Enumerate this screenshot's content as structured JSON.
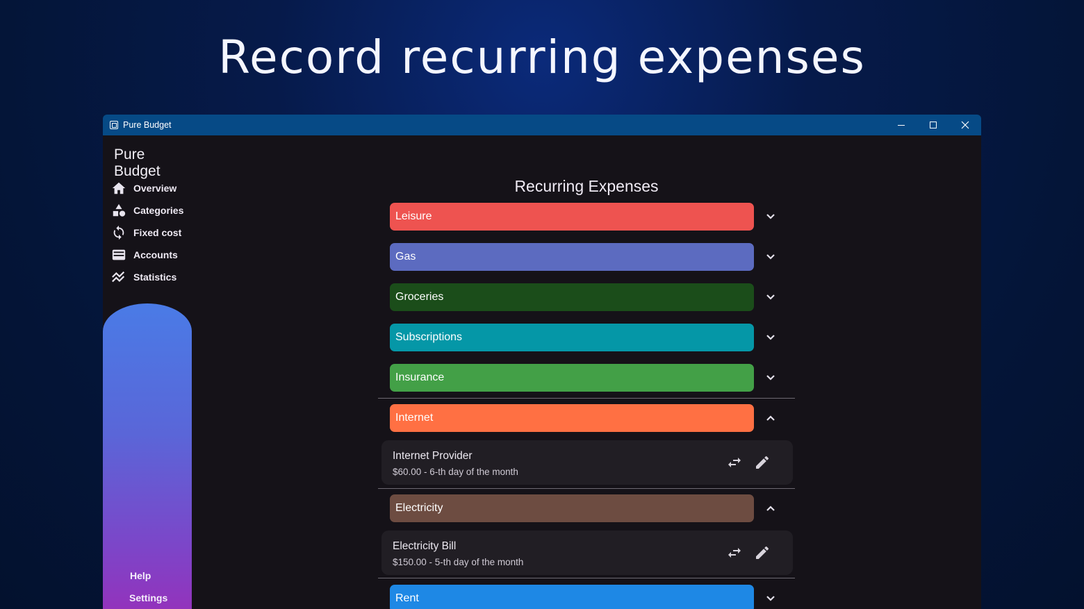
{
  "headline": "Record recurring expenses",
  "window": {
    "title": "Pure Budget",
    "controls": {
      "minimize": "minimize-icon",
      "maximize": "maximize-icon",
      "close": "close-icon"
    }
  },
  "sidebar": {
    "app_title": "Pure Budget",
    "items": [
      {
        "label": "Overview",
        "icon": "home-icon"
      },
      {
        "label": "Categories",
        "icon": "shapes-icon"
      },
      {
        "label": "Fixed cost",
        "icon": "sync-icon"
      },
      {
        "label": "Accounts",
        "icon": "wallet-icon"
      },
      {
        "label": "Statistics",
        "icon": "chart-icon"
      }
    ],
    "help": "Help",
    "settings": "Settings"
  },
  "main": {
    "title": "Recurring Expenses",
    "categories": [
      {
        "name": "Leisure",
        "color": "#ee5350",
        "expanded": false
      },
      {
        "name": "Gas",
        "color": "#5c6bc0",
        "expanded": false
      },
      {
        "name": "Groceries",
        "color": "#1b4d1a",
        "expanded": false
      },
      {
        "name": "Subscriptions",
        "color": "#0597a7",
        "expanded": false
      },
      {
        "name": "Insurance",
        "color": "#43a047",
        "expanded": false
      },
      {
        "name": "Internet",
        "color": "#ff7043",
        "expanded": true
      },
      {
        "name": "Electricity",
        "color": "#6d4c41",
        "expanded": true
      },
      {
        "name": "Rent",
        "color": "#1e88e5",
        "expanded": false
      }
    ],
    "expenses": [
      {
        "name": "Internet Provider",
        "detail": "$60.00 - 6-th day of the month"
      },
      {
        "name": "Electricity Bill",
        "detail": "$150.00 - 5-th day of the month"
      }
    ]
  }
}
